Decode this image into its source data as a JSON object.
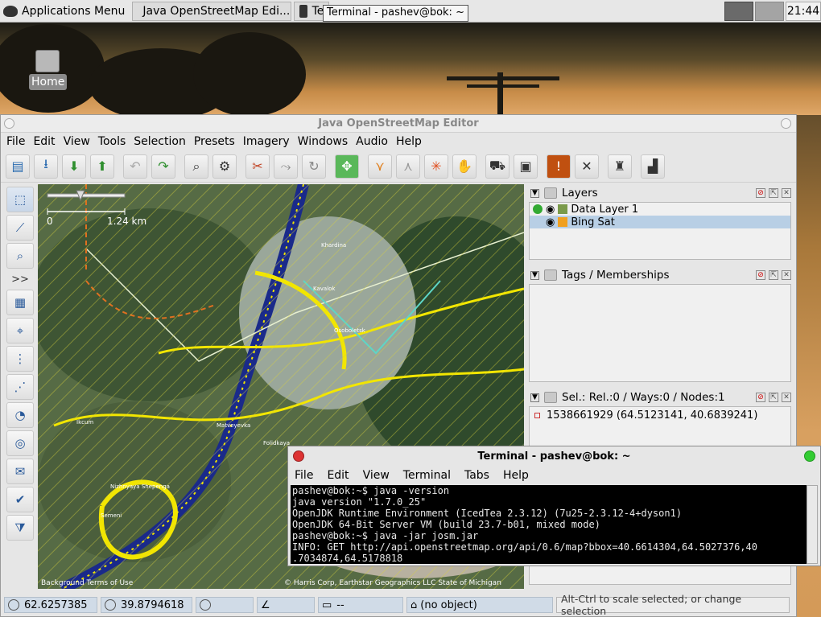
{
  "topbar": {
    "apps_menu": "Applications Menu",
    "tasks": [
      {
        "label": "Java OpenStreetMap Edi..."
      },
      {
        "label": "Te"
      }
    ],
    "tooltip": "Terminal - pashev@bok: ~",
    "clock": "21:44"
  },
  "desktop": {
    "home_label": "Home"
  },
  "josm": {
    "title": "Java OpenStreetMap Editor",
    "menu": [
      "File",
      "Edit",
      "View",
      "Tools",
      "Selection",
      "Presets",
      "Imagery",
      "Windows",
      "Audio",
      "Help"
    ],
    "toolbar_icons": [
      "open-icon",
      "save-icon",
      "download-icon",
      "upload-icon",
      "undo-icon",
      "redo-icon",
      "zoom-icon",
      "preferences-icon",
      "split-icon",
      "combine-icon",
      "refresh-icon",
      "zoom-to-icon",
      "node-icon",
      "way-icon",
      "line-icon",
      "hand-icon",
      "car-icon",
      "bus-icon",
      "warning-icon",
      "tools-icon",
      "castle-icon",
      "factory-icon"
    ],
    "left_tools_more": ">>",
    "scale": {
      "zero": "0",
      "distance": "1.24 km"
    },
    "map": {
      "attribution_left": "Background Terms of Use",
      "attribution_right": "© Harris Corp, Earthstar Geographics LLC State of Michigan",
      "places": [
        "Khardina",
        "Kavalok",
        "Osoboletsk",
        "Matveyevka",
        "Folidkaya",
        "Ikcum",
        "Nizhnyaya Shepenga",
        "Semeni"
      ]
    },
    "layers": {
      "title": "Layers",
      "items": [
        {
          "name": "Data Layer 1"
        },
        {
          "name": "Bing Sat"
        }
      ]
    },
    "tags": {
      "title": "Tags / Memberships"
    },
    "selection": {
      "title": "Sel.: Rel.:0 / Ways:0 / Nodes:1",
      "item": "1538661929 (64.5123141, 40.6839241)"
    },
    "status": {
      "lat": "62.6257385",
      "lon": "39.8794618",
      "heading": "",
      "angle": "",
      "distance": "--",
      "object": "(no object)",
      "help": "Alt-Ctrl to scale selected; or change selection"
    }
  },
  "terminal": {
    "title": "Terminal - pashev@bok: ~",
    "menu": [
      "File",
      "Edit",
      "View",
      "Terminal",
      "Tabs",
      "Help"
    ],
    "lines": [
      "pashev@bok:~$ java -version",
      "java version \"1.7.0_25\"",
      "OpenJDK Runtime Environment (IcedTea 2.3.12) (7u25-2.3.12-4+dyson1)",
      "OpenJDK 64-Bit Server VM (build 23.7-b01, mixed mode)",
      "pashev@bok:~$ java -jar josm.jar",
      "INFO: GET http://api.openstreetmap.org/api/0.6/map?bbox=40.6614304,64.5027376,40",
      ".7034874,64.5178818"
    ]
  }
}
